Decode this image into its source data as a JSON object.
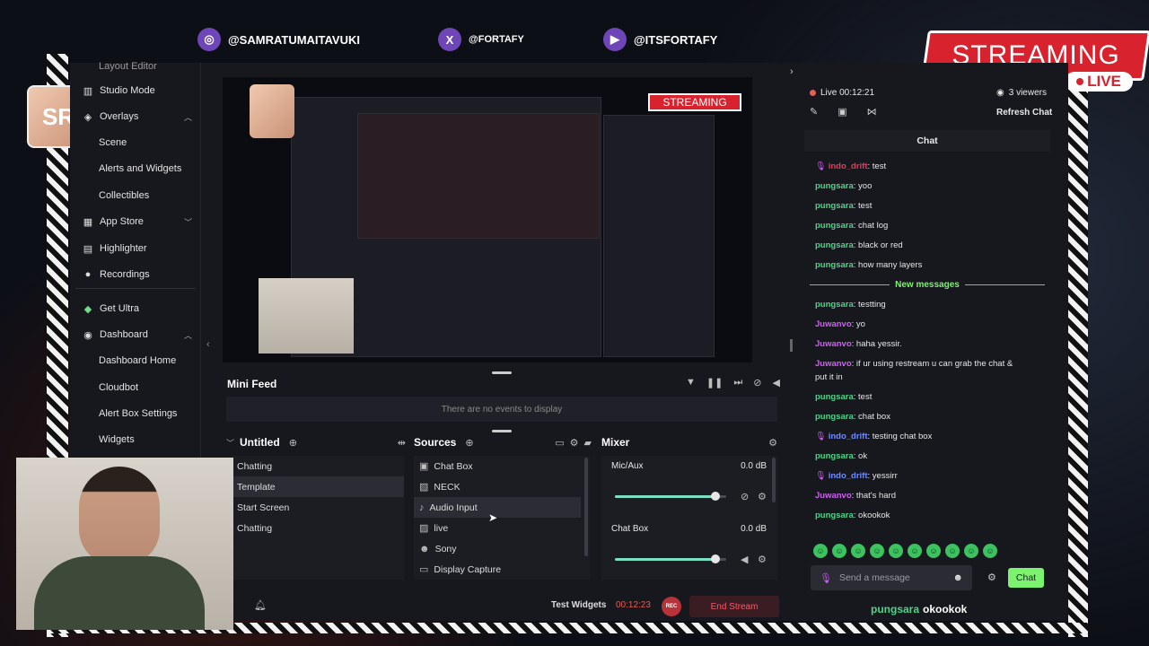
{
  "social": {
    "instagram": "@SAMRATUMAITAVUKI",
    "twitter": "@FORTAFY",
    "youtube": "@ITSFORTAFY"
  },
  "overlay": {
    "streaming": "STREAMING",
    "live": "LIVE"
  },
  "sidebar": {
    "partial_item": "Layout Editor",
    "items": [
      {
        "label": "Studio Mode",
        "icon": "studio-icon"
      },
      {
        "label": "Overlays",
        "icon": "overlays-icon"
      },
      {
        "label": "Scene"
      },
      {
        "label": "Alerts and Widgets"
      },
      {
        "label": "Collectibles"
      },
      {
        "label": "App Store",
        "icon": "app-store-icon"
      },
      {
        "label": "Highlighter",
        "icon": "highlighter-icon"
      },
      {
        "label": "Recordings",
        "icon": "recordings-icon"
      },
      {
        "label": "Get Ultra",
        "icon": "ultra-icon"
      },
      {
        "label": "Dashboard",
        "icon": "dashboard-icon"
      },
      {
        "label": "Dashboard Home"
      },
      {
        "label": "Cloudbot"
      },
      {
        "label": "Alert Box Settings"
      },
      {
        "label": "Widgets"
      }
    ]
  },
  "minifeed": {
    "title": "Mini Feed",
    "empty": "There are no events to display"
  },
  "scenes": {
    "title": "Untitled",
    "items": [
      "Chatting",
      "Template",
      "Start Screen",
      "Chatting"
    ],
    "selected": 1
  },
  "sources": {
    "title": "Sources",
    "items": [
      {
        "label": "Chat Box",
        "icon": "chat-icon"
      },
      {
        "label": "NECK",
        "icon": "image-icon"
      },
      {
        "label": "Audio Input",
        "icon": "mic-icon"
      },
      {
        "label": "live",
        "icon": "image-icon"
      },
      {
        "label": "Sony",
        "icon": "camera-icon"
      },
      {
        "label": "Display Capture",
        "icon": "display-icon"
      }
    ]
  },
  "mixer": {
    "title": "Mixer",
    "channels": [
      {
        "name": "Mic/Aux",
        "db": "0.0 dB",
        "level": 0.9
      },
      {
        "name": "Chat Box",
        "db": "0.0 dB",
        "level": 0.9
      }
    ]
  },
  "footer": {
    "test_widgets": "Test Widgets",
    "timer": "00:12:23",
    "rec": "REC",
    "end_stream": "End Stream"
  },
  "chat": {
    "live_time": "Live 00:12:21",
    "viewers": "3 viewers",
    "refresh": "Refresh Chat",
    "title": "Chat",
    "new_messages": "New messages",
    "messages": [
      {
        "user": "indo_drift",
        "text": ": test",
        "color": "#e23d5b",
        "badge": true
      },
      {
        "user": "pungsara",
        "text": ": yoo",
        "color": "#4fd38a"
      },
      {
        "user": "pungsara",
        "text": ": test",
        "color": "#4fd38a"
      },
      {
        "user": "pungsara",
        "text": ": chat log",
        "color": "#4fd38a"
      },
      {
        "user": "pungsara",
        "text": ": black or red",
        "color": "#4fd38a"
      },
      {
        "user": "pungsara",
        "text": ": how many layers",
        "color": "#4fd38a"
      },
      {
        "user": "pungsara",
        "text": ": testting",
        "color": "#4fd38a"
      },
      {
        "user": "Juwanvo",
        "text": ": yo",
        "color": "#d25ef5"
      },
      {
        "user": "Juwanvo",
        "text": ": haha yessir.",
        "color": "#d25ef5"
      },
      {
        "user": "Juwanvo",
        "text": ": if ur using restream u can grab the chat &",
        "color": "#d25ef5"
      },
      {
        "user": "",
        "text": "put it in",
        "color": "#d25ef5"
      },
      {
        "user": "pungsara",
        "text": ": test",
        "color": "#4fd38a"
      },
      {
        "user": "pungsara",
        "text": ": chat box",
        "color": "#4fd38a"
      },
      {
        "user": "indo_drift",
        "text": ": testing chat box",
        "color": "#6f8cff",
        "badge": true
      },
      {
        "user": "pungsara",
        "text": ": ok",
        "color": "#4fd38a"
      },
      {
        "user": "indo_drift",
        "text": ": yessirr",
        "color": "#6f8cff",
        "badge": true
      },
      {
        "user": "Juwanvo",
        "text": ": that's hard",
        "color": "#d25ef5"
      },
      {
        "user": "pungsara",
        "text": ": okookok",
        "color": "#4fd38a"
      }
    ],
    "placeholder": "Send a message",
    "send": "Chat",
    "overlay_user": "pungsara",
    "overlay_text": "okookok"
  }
}
